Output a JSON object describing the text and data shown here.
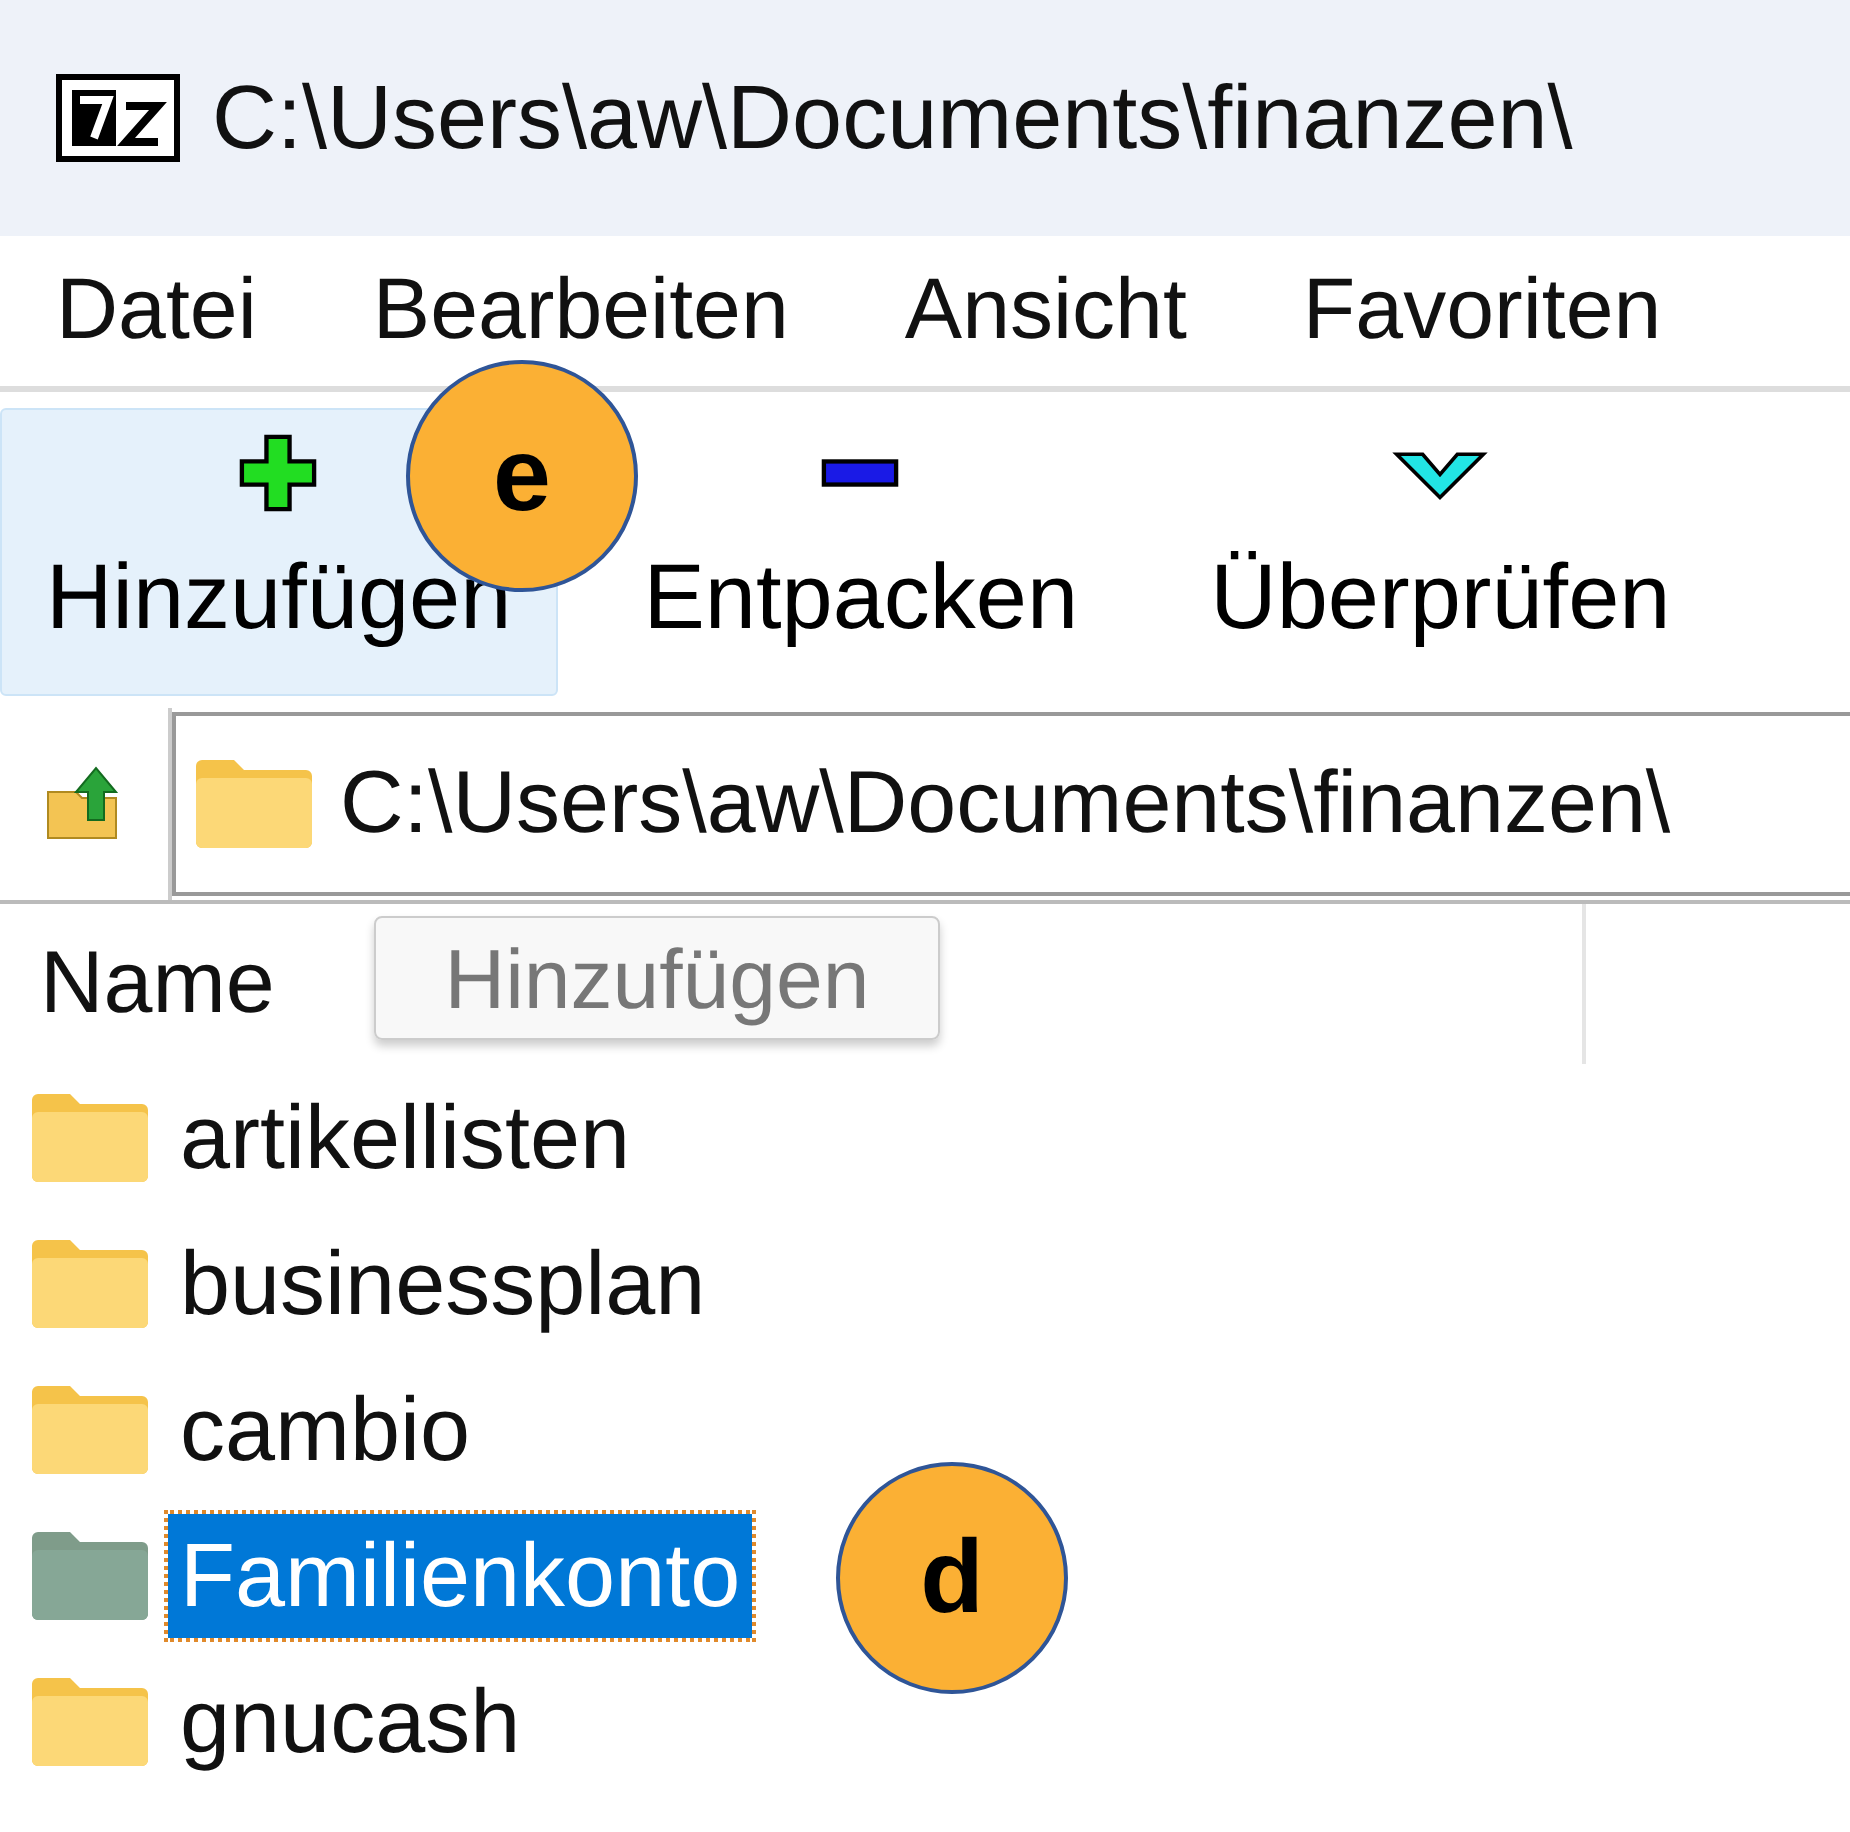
{
  "window": {
    "title": "C:\\Users\\aw\\Documents\\finanzen\\"
  },
  "menu": [
    "Datei",
    "Bearbeiten",
    "Ansicht",
    "Favoriten"
  ],
  "toolbar": [
    {
      "kind": "add",
      "label": "Hinzufügen",
      "hovered": true,
      "callout": "e"
    },
    {
      "kind": "extract",
      "label": "Entpacken",
      "hovered": false
    },
    {
      "kind": "test",
      "label": "Überprüfen",
      "hovered": false
    }
  ],
  "address": {
    "value": "C:\\Users\\aw\\Documents\\finanzen\\"
  },
  "tooltip": {
    "text": "Hinzufügen"
  },
  "list": {
    "columns": [
      "Name"
    ],
    "rows": [
      {
        "name": "artikellisten",
        "selected": false
      },
      {
        "name": "businessplan",
        "selected": false
      },
      {
        "name": "cambio",
        "selected": false
      },
      {
        "name": "Familienkonto",
        "selected": true,
        "callout": "d"
      },
      {
        "name": "gnucash",
        "selected": false
      }
    ]
  }
}
